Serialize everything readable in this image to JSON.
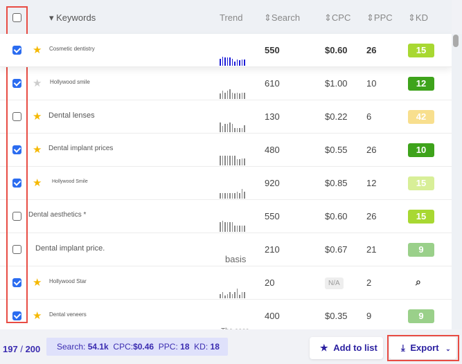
{
  "header": {
    "keywords": "Keywords",
    "trend": "Trend",
    "search": "Search",
    "cpc": "CPC",
    "ppc": "PPC",
    "kd": "KD"
  },
  "rows": [
    {
      "checked": true,
      "star": "gold",
      "keyword": "Cosmetic dentistry",
      "search": "550",
      "cpc": "$0.60",
      "ppc": "26",
      "kd": "15",
      "kd_color": "#a8d832",
      "trend": [
        8,
        10,
        9,
        9,
        9,
        8,
        5,
        7,
        6,
        7,
        7
      ]
    },
    {
      "checked": true,
      "star": "grey",
      "keyword": "Hollywood smile",
      "search": "610",
      "cpc": "$1.00",
      "ppc": "10",
      "kd": "12",
      "kd_color": "#3ea31b",
      "trend": [
        6,
        9,
        7,
        9,
        11,
        7,
        6,
        7,
        6,
        7,
        7
      ]
    },
    {
      "checked": false,
      "star": "gold",
      "keyword": "Dental lenses",
      "search": "130",
      "cpc": "$0.22",
      "ppc": "6",
      "kd": "42",
      "kd_color": "#f8df8e",
      "trend": [
        11,
        7,
        9,
        9,
        11,
        9,
        5,
        5,
        5,
        5,
        8
      ]
    },
    {
      "checked": true,
      "star": "gold",
      "keyword": "Dental implant prices",
      "search": "480",
      "cpc": "$0.55",
      "ppc": "26",
      "kd": "10",
      "kd_color": "#3ea31b",
      "trend": [
        11,
        11,
        11,
        11,
        11,
        11,
        11,
        7,
        7,
        8,
        8
      ]
    },
    {
      "checked": true,
      "star": "gold",
      "keyword": "Hollywood Smile",
      "search": "920",
      "cpc": "$0.85",
      "ppc": "12",
      "kd": "15",
      "kd_color": "#d8ef98",
      "trend": [
        6,
        6,
        6,
        6,
        6,
        6,
        6,
        8,
        6,
        11,
        8
      ]
    },
    {
      "checked": false,
      "star": null,
      "keyword": "Dental aesthetics *",
      "search": "550",
      "cpc": "$0.60",
      "ppc": "26",
      "kd": "15",
      "kd_color": "#a8d832",
      "trend": [
        11,
        12,
        11,
        11,
        11,
        11,
        7,
        7,
        7,
        7,
        7
      ]
    },
    {
      "checked": false,
      "star": null,
      "keyword": "Dental implant price.",
      "search": "210",
      "cpc": "$0.67",
      "ppc": "21",
      "kd": "9",
      "kd_color": "#9ad08a",
      "trend": [],
      "overlay": "basis"
    },
    {
      "checked": true,
      "star": "gold",
      "keyword": "Hollywood Star",
      "search": "20",
      "cpc": "N/A",
      "ppc": "2",
      "kd": "",
      "kd_color": "",
      "trend": [
        5,
        7,
        3,
        5,
        7,
        5,
        7,
        11,
        4,
        7,
        7
      ]
    },
    {
      "checked": true,
      "star": "gold",
      "keyword": "Dental veneers",
      "search": "400",
      "cpc": "$0.35",
      "ppc": "9",
      "kd": "9",
      "kd_color": "#9ad08a",
      "trend": [],
      "overlay": "The sass"
    }
  ],
  "footer": {
    "selected": "197",
    "total": "200",
    "search_label": "Search:",
    "search": "54.1k",
    "cpc_label": "CPC:",
    "cpc": "$0.46",
    "ppc_label": "PPC:",
    "ppc": "18",
    "kd_label": "KD:",
    "kd": "18",
    "add_to_list": "Add to list",
    "export": "Export"
  }
}
